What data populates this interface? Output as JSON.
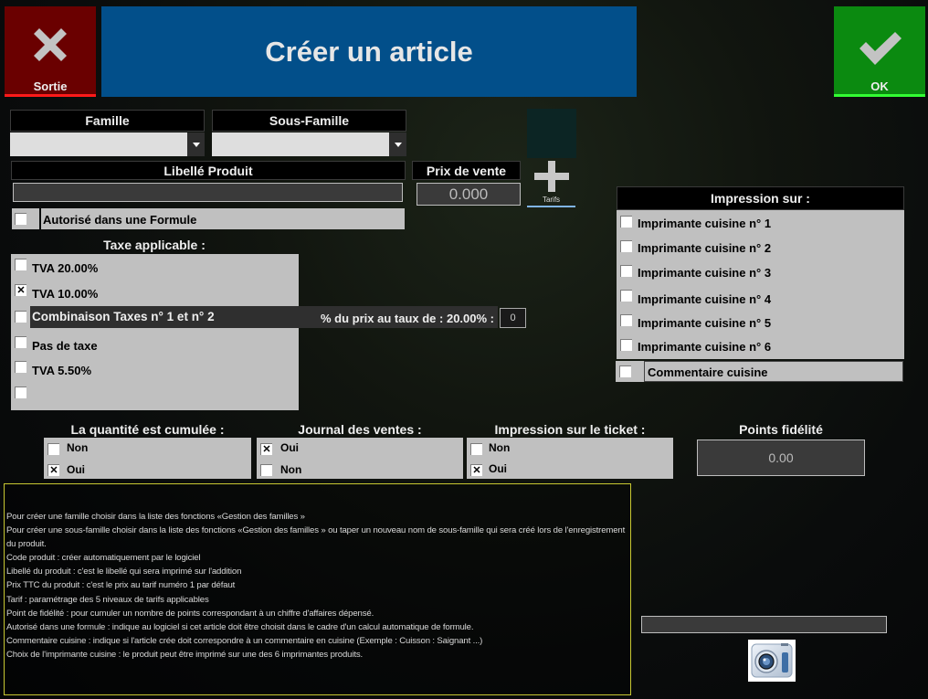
{
  "header": {
    "title": "Créer un article",
    "exit_label": "Sortie",
    "ok_label": "OK"
  },
  "famille": {
    "label": "Famille",
    "value": ""
  },
  "sous_famille": {
    "label": "Sous-Famille",
    "value": ""
  },
  "libelle": {
    "label": "Libellé Produit",
    "value": ""
  },
  "prix": {
    "label": "Prix de vente",
    "value": "0.000"
  },
  "tarifs": {
    "label": "Tarifs"
  },
  "formule": {
    "label": "Autorisé dans une Formule",
    "checked": false
  },
  "taxe": {
    "title": "Taxe applicable :",
    "options": [
      {
        "label": "TVA 20.00%",
        "checked": false,
        "mark": ""
      },
      {
        "label": "TVA 10.00%",
        "checked": true,
        "mark": "✕"
      },
      {
        "label": "Combinaison Taxes n° 1 et n° 2",
        "checked": false,
        "mark": ""
      },
      {
        "label": "Pas de taxe",
        "checked": false,
        "mark": ""
      },
      {
        "label": "TVA 5.50%",
        "checked": false,
        "mark": ""
      },
      {
        "label": "",
        "checked": false,
        "mark": ""
      }
    ],
    "combo_pct_label": "% du prix au taux de : 20.00% :",
    "combo_pct_value": "0"
  },
  "impression": {
    "title": "Impression sur :",
    "printers": [
      {
        "label": "Imprimante cuisine n° 1",
        "checked": false
      },
      {
        "label": "Imprimante cuisine n° 2",
        "checked": false
      },
      {
        "label": "Imprimante cuisine n° 3",
        "checked": false
      },
      {
        "label": "Imprimante cuisine n° 4",
        "checked": false
      },
      {
        "label": "Imprimante cuisine n° 5",
        "checked": false
      },
      {
        "label": "Imprimante cuisine n° 6",
        "checked": false
      }
    ],
    "commentaire_label": "Commentaire cuisine",
    "commentaire_checked": false
  },
  "quantite": {
    "title": "La quantité est cumulée :",
    "options": [
      {
        "label": "Non",
        "mark": ""
      },
      {
        "label": "Oui",
        "mark": "✕"
      }
    ]
  },
  "journal": {
    "title": "Journal des ventes :",
    "options": [
      {
        "label": "Oui",
        "mark": "✕"
      },
      {
        "label": "Non",
        "mark": ""
      }
    ]
  },
  "ticket": {
    "title": "Impression sur le  ticket :",
    "options": [
      {
        "label": "Non",
        "mark": ""
      },
      {
        "label": "Oui",
        "mark": "✕"
      }
    ]
  },
  "fidelite": {
    "title": "Points fidélité",
    "value": "0.00"
  },
  "image_field": {
    "value": ""
  },
  "help": {
    "lines": [
      "Pour créer une famille choisir dans la liste des fonctions «Gestion des familles »",
      "Pour créer une sous-famille choisir dans la liste des fonctions «Gestion des familles » ou taper un nouveau nom de sous-famille qui sera créé lors de l'enregistrement",
      "du produit.",
      "Code produit : créer automatiquement par le logiciel",
      "Libellé du produit : c'est le libellé qui sera imprimé sur l'addition",
      "Prix TTC du produit : c'est le prix au tarif numéro 1 par défaut",
      "Tarif : paramétrage des 5 niveaux de tarifs applicables",
      "Point de fidélité : pour cumuler un nombre de points correspondant à un chiffre d'affaires dépensé.",
      "Autorisé dans une formule : indique au logiciel si cet article doit être choisit dans le cadre d'un calcul automatique de formule.",
      "Commentaire cuisine : indique si l'article crée doit correspondre à un commentaire en cuisine (Exemple : Cuisson : Saignant ...)",
      "Choix de l'imprimante cuisine : le produit peut être imprimé sur une des 6 imprimantes produits."
    ]
  }
}
